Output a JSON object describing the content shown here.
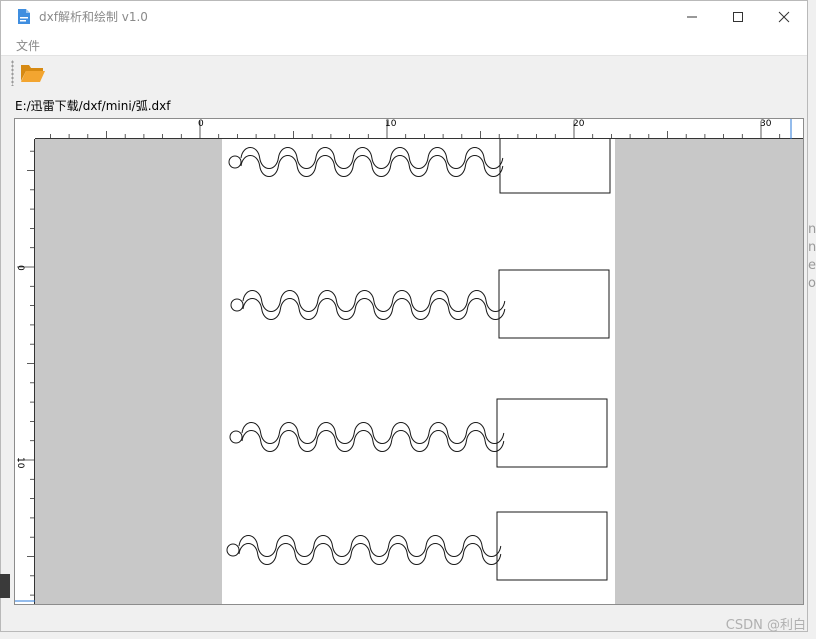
{
  "window": {
    "title": "dxf解析和绘制 v1.0"
  },
  "menu": {
    "items": [
      "文件"
    ]
  },
  "toolbar": {
    "open_icon": "folder-open-icon"
  },
  "file_path": "E:/迅雷下载/dxf/mini/弧.dxf",
  "ruler": {
    "h_labels": [
      "0",
      "10",
      "20",
      "30"
    ],
    "v_labels": [
      "0",
      "10"
    ]
  },
  "drawing": {
    "shapes": [
      "serpentine-with-pad-1",
      "serpentine-with-pad-2",
      "serpentine-with-pad-3",
      "serpentine-with-pad-4"
    ]
  },
  "watermark": "CSDN @利白",
  "colors": {
    "canvas_bg": "#c8c8c8",
    "sheet_bg": "#ffffff",
    "stroke": "#1a1a1a",
    "folder": "#f0a42a"
  }
}
